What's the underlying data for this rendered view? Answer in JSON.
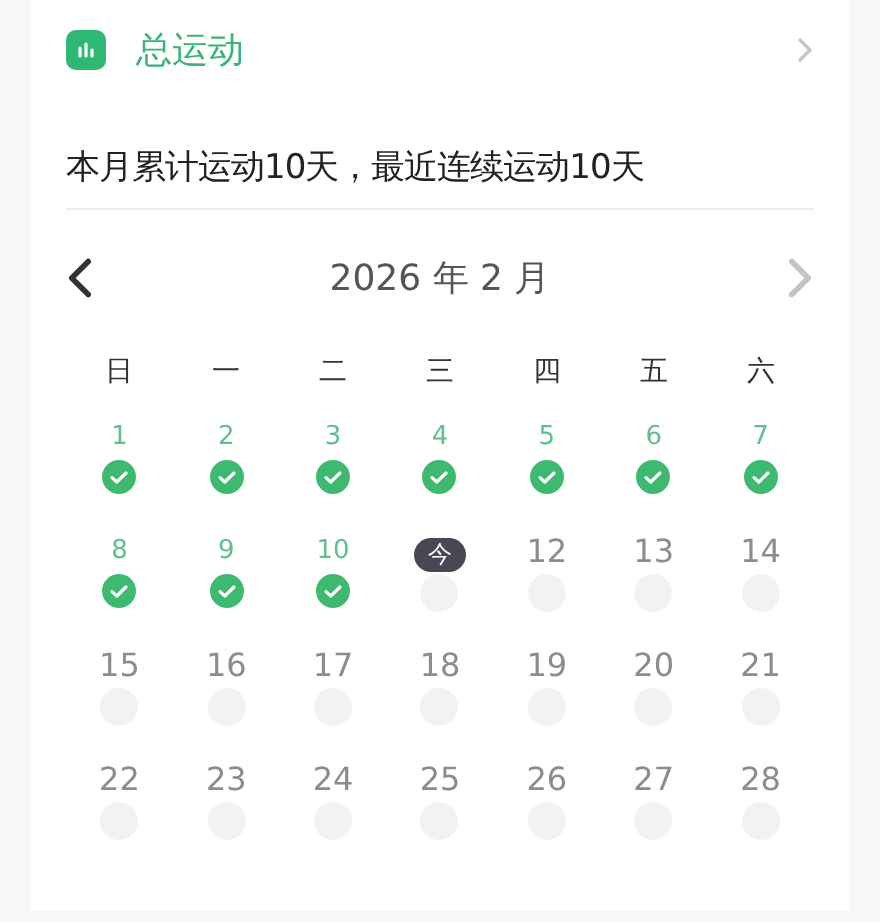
{
  "header": {
    "title": "总运动"
  },
  "summary": "本月累计运动10天，最近连续运动10天",
  "month": {
    "label": "2026 年 2 月",
    "prev_enabled": true,
    "next_enabled": false
  },
  "weekdays": [
    "日",
    "一",
    "二",
    "三",
    "四",
    "五",
    "六"
  ],
  "days": [
    {
      "label": "1",
      "done": true,
      "today": false
    },
    {
      "label": "2",
      "done": true,
      "today": false
    },
    {
      "label": "3",
      "done": true,
      "today": false
    },
    {
      "label": "4",
      "done": true,
      "today": false
    },
    {
      "label": "5",
      "done": true,
      "today": false
    },
    {
      "label": "6",
      "done": true,
      "today": false
    },
    {
      "label": "7",
      "done": true,
      "today": false
    },
    {
      "label": "8",
      "done": true,
      "today": false
    },
    {
      "label": "9",
      "done": true,
      "today": false
    },
    {
      "label": "10",
      "done": true,
      "today": false
    },
    {
      "label": "今",
      "done": false,
      "today": true
    },
    {
      "label": "12",
      "done": false,
      "today": false
    },
    {
      "label": "13",
      "done": false,
      "today": false
    },
    {
      "label": "14",
      "done": false,
      "today": false
    },
    {
      "label": "15",
      "done": false,
      "today": false
    },
    {
      "label": "16",
      "done": false,
      "today": false
    },
    {
      "label": "17",
      "done": false,
      "today": false
    },
    {
      "label": "18",
      "done": false,
      "today": false
    },
    {
      "label": "19",
      "done": false,
      "today": false
    },
    {
      "label": "20",
      "done": false,
      "today": false
    },
    {
      "label": "21",
      "done": false,
      "today": false
    },
    {
      "label": "22",
      "done": false,
      "today": false
    },
    {
      "label": "23",
      "done": false,
      "today": false
    },
    {
      "label": "24",
      "done": false,
      "today": false
    },
    {
      "label": "25",
      "done": false,
      "today": false
    },
    {
      "label": "26",
      "done": false,
      "today": false
    },
    {
      "label": "27",
      "done": false,
      "today": false
    },
    {
      "label": "28",
      "done": false,
      "today": false
    }
  ]
}
